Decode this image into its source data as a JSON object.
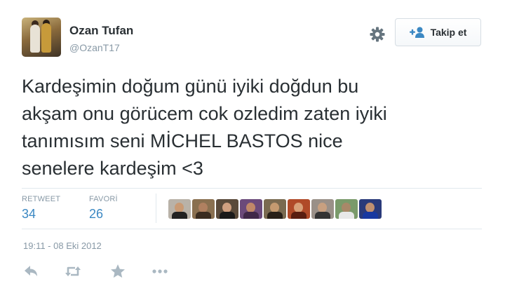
{
  "tweet": {
    "author": {
      "name": "Ozan Tufan",
      "handle": "@OzanT17"
    },
    "follow_button": {
      "label": "Takip et",
      "icon": "add-user-icon"
    },
    "settings_icon": "gear-icon",
    "text_lines": [
      "Kardeşimin doğum günü iyiki doğdun bu",
      "akşam onu görücem cok ozledim zaten iyiki",
      "tanımısım seni MİCHEL BASTOS nice",
      "senelere kardeşim <3"
    ],
    "stats": {
      "retweet": {
        "label": "RETWEET",
        "count": "34"
      },
      "favorite": {
        "label": "FAVORİ",
        "count": "26"
      }
    },
    "favoriters_count_shown": 9,
    "timestamp": "19:11 - 08 Eki 2012",
    "actions": [
      "reply-icon",
      "retweet-icon",
      "favorite-star-icon",
      "more-icon"
    ],
    "colors": {
      "text": "#292f33",
      "muted": "#8899a6",
      "stat_count": "#3b88c3",
      "follow_icon": "#3b88c3",
      "divider": "#e1e8ed"
    }
  }
}
